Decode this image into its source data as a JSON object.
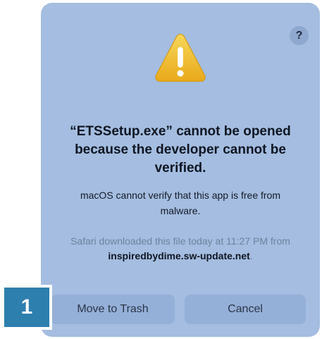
{
  "dialog": {
    "help_label": "?",
    "icon": "warning-triangle-icon",
    "title": "“ETSSetup.exe” cannot be opened because the developer cannot be verified.",
    "message": "macOS cannot verify that this app is free from malware.",
    "source_prefix": "Safari downloaded this file today at 11:27 PM from ",
    "source_host": "inspiredbydime.sw-update.net",
    "source_suffix": ".",
    "buttons": {
      "trash": "Move to Trash",
      "cancel": "Cancel"
    }
  },
  "step_badge": {
    "number": "1"
  },
  "colors": {
    "dialog_bg": "#a4bde0",
    "button_bg": "#95b0d8",
    "warning_yellow": "#f2c12e",
    "badge_blue": "#2d7fae"
  }
}
